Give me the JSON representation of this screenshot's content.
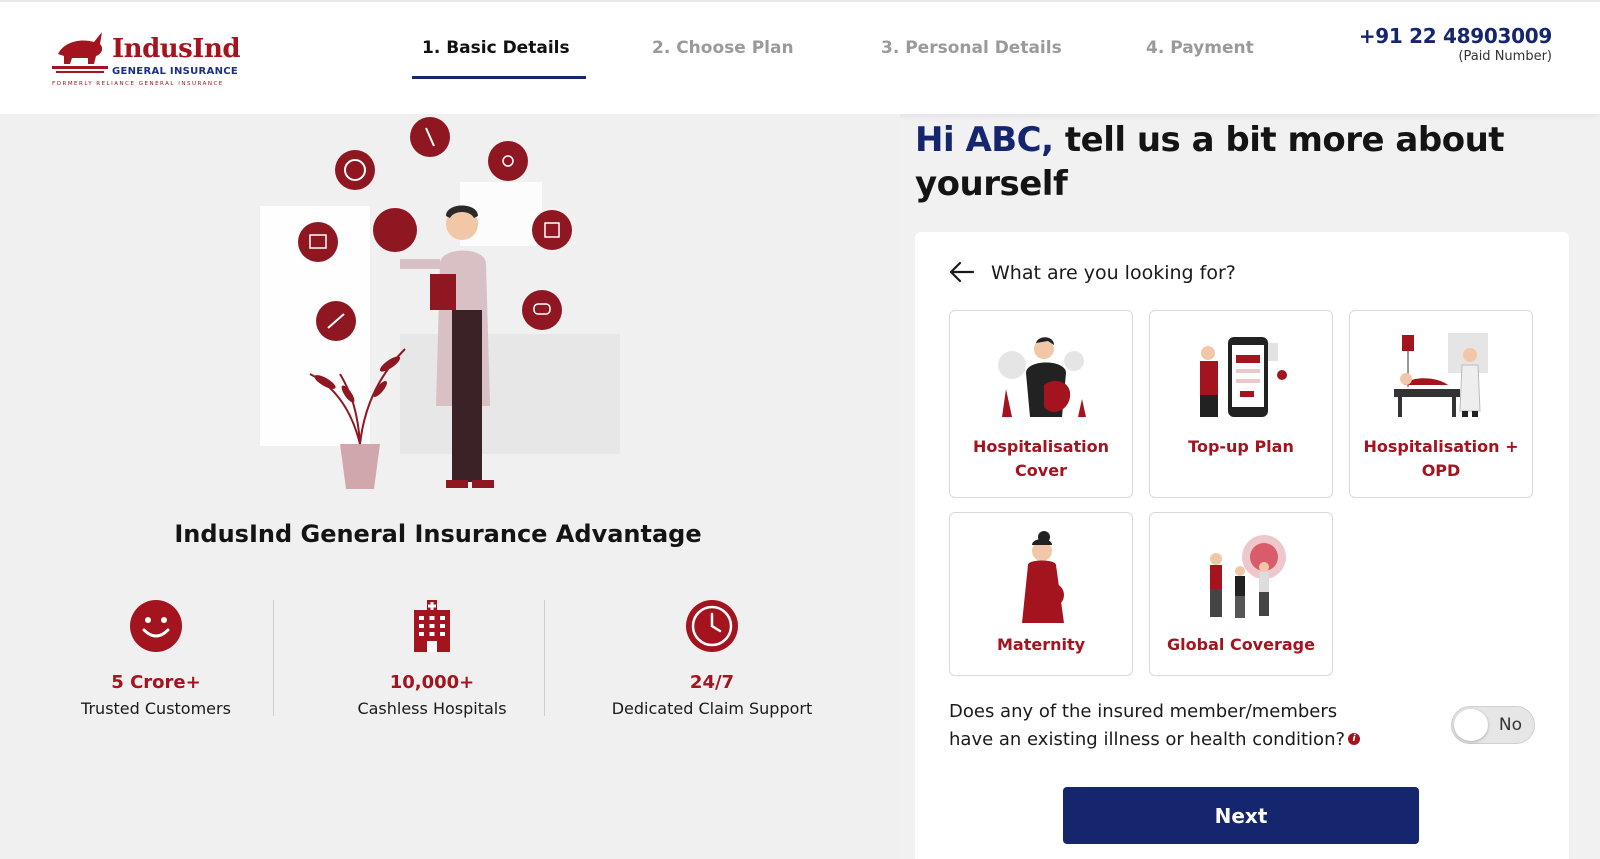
{
  "header": {
    "brand": "IndusInd",
    "brand_sub": "GENERAL INSURANCE",
    "brand_tag": "FORMERLY RELIANCE GENERAL INSURANCE",
    "steps": [
      {
        "label": "1. Basic Details",
        "active": true
      },
      {
        "label": "2. Choose Plan",
        "active": false
      },
      {
        "label": "3. Personal Details",
        "active": false
      },
      {
        "label": "4. Payment",
        "active": false
      }
    ],
    "phone": "+91 22 48903009",
    "phone_note": "(Paid Number)"
  },
  "advantage": {
    "title": "IndusInd General Insurance Advantage",
    "stats": [
      {
        "value": "5 Crore+",
        "label": "Trusted Customers",
        "icon": "smiley-icon"
      },
      {
        "value": "10,000+",
        "label": "Cashless Hospitals",
        "icon": "hospital-icon"
      },
      {
        "value": "24/7",
        "label": "Dedicated Claim Support",
        "icon": "clock-icon"
      }
    ]
  },
  "form": {
    "greeting_name": "Hi ABC,",
    "greeting_rest": " tell us a bit more about yourself",
    "question": "What are you looking for?",
    "options": [
      {
        "label": "Hospitalisation Cover"
      },
      {
        "label": "Top-up Plan"
      },
      {
        "label": "Hospitalisation + OPD"
      },
      {
        "label": "Maternity"
      },
      {
        "label": "Global Coverage"
      }
    ],
    "illness_question": "Does any of the insured member/members have an existing illness or health condition?",
    "info_glyph": "i",
    "toggle_label": "No",
    "next_label": "Next"
  },
  "colors": {
    "brand_red": "#a3141f",
    "brand_navy": "#15266e"
  }
}
